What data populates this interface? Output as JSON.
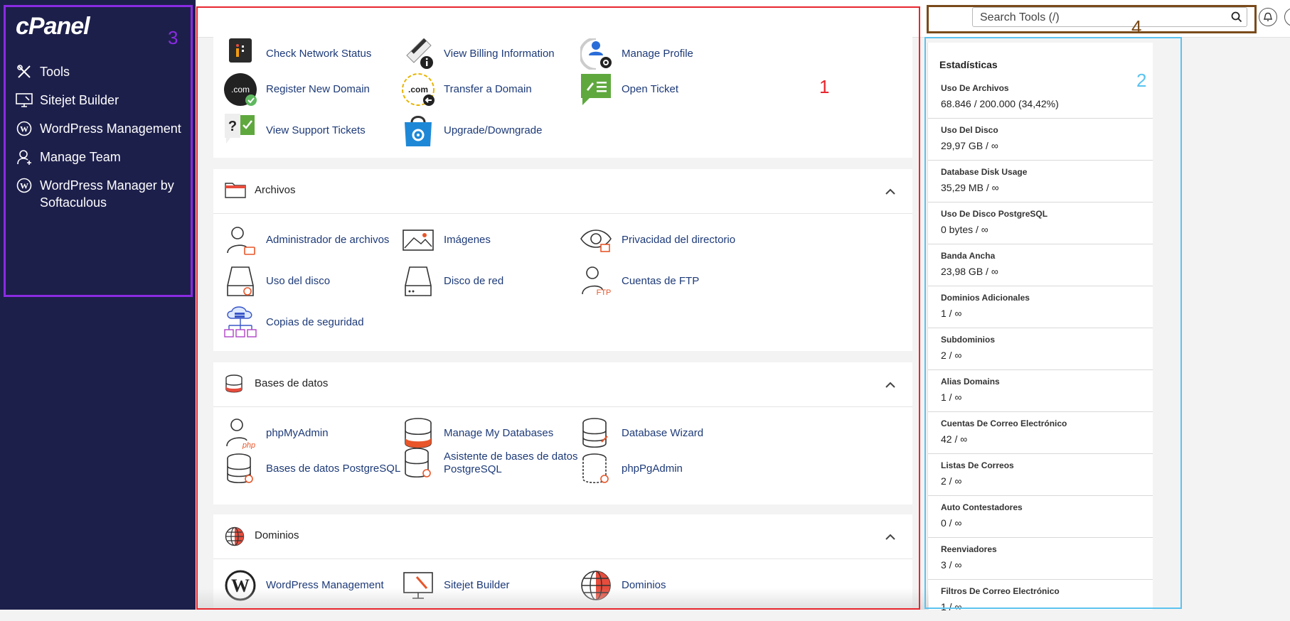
{
  "sidebar": {
    "logo": "cPanel",
    "items": [
      {
        "label": "Tools",
        "icon": "tools-icon"
      },
      {
        "label": "Sitejet Builder",
        "icon": "monitor-icon"
      },
      {
        "label": "WordPress Management",
        "icon": "wordpress-icon"
      },
      {
        "label": "Manage Team",
        "icon": "user-icon"
      },
      {
        "label": "WordPress Manager by Softaculous",
        "icon": "wordpress-icon"
      }
    ]
  },
  "header": {
    "search_placeholder": "Search Tools (/)"
  },
  "annotations": {
    "box1": "1",
    "box2": "2",
    "box3": "3",
    "box4": "4",
    "colors": {
      "box1": "#e8262f",
      "box2": "#5bc3f0",
      "box3": "#8a2be2",
      "box4": "#7a4a1a"
    }
  },
  "general": {
    "tools": [
      {
        "label": "Check Network Status",
        "icon": "network-status-icon"
      },
      {
        "label": "View Billing Information",
        "icon": "billing-icon"
      },
      {
        "label": "Manage Profile",
        "icon": "profile-icon"
      },
      {
        "label": "Register New Domain",
        "icon": "register-domain-icon"
      },
      {
        "label": "Transfer a Domain",
        "icon": "transfer-domain-icon"
      },
      {
        "label": "Open Ticket",
        "icon": "ticket-icon"
      },
      {
        "label": "View Support Tickets",
        "icon": "support-tickets-icon"
      },
      {
        "label": "Upgrade/Downgrade",
        "icon": "upgrade-icon"
      }
    ]
  },
  "archivos": {
    "title": "Archivos",
    "tools": [
      {
        "label": "Administrador de archivos",
        "icon": "file-manager-icon"
      },
      {
        "label": "Imágenes",
        "icon": "images-icon"
      },
      {
        "label": "Privacidad del directorio",
        "icon": "directory-privacy-icon"
      },
      {
        "label": "Uso del disco",
        "icon": "disk-usage-icon"
      },
      {
        "label": "Disco de red",
        "icon": "network-disk-icon"
      },
      {
        "label": "Cuentas de FTP",
        "icon": "ftp-icon"
      },
      {
        "label": "Copias de seguridad",
        "icon": "backup-icon"
      }
    ]
  },
  "bases": {
    "title": "Bases de datos",
    "tools": [
      {
        "label": "phpMyAdmin",
        "icon": "phpmyadmin-icon"
      },
      {
        "label": "Manage My Databases",
        "icon": "database-icon"
      },
      {
        "label": "Database Wizard",
        "icon": "database-wizard-icon"
      },
      {
        "label": "Bases de datos PostgreSQL",
        "icon": "postgresql-icon"
      },
      {
        "label": "Asistente de bases de datos PostgreSQL",
        "icon": "postgresql-wizard-icon"
      },
      {
        "label": "phpPgAdmin",
        "icon": "phppgadmin-icon"
      }
    ]
  },
  "dominios": {
    "title": "Dominios",
    "tools": [
      {
        "label": "WordPress Management",
        "icon": "wordpress-icon"
      },
      {
        "label": "Sitejet Builder",
        "icon": "sitejet-icon"
      },
      {
        "label": "Dominios",
        "icon": "globe-icon"
      }
    ]
  },
  "stats": {
    "title": "Estadísticas",
    "items": [
      {
        "label": "Uso De Archivos",
        "value": "68.846 / 200.000   (34,42%)"
      },
      {
        "label": "Uso Del Disco",
        "value": "29,97 GB / ∞"
      },
      {
        "label": "Database Disk Usage",
        "value": "35,29 MB / ∞"
      },
      {
        "label": "Uso De Disco PostgreSQL",
        "value": "0 bytes / ∞"
      },
      {
        "label": "Banda Ancha",
        "value": "23,98 GB / ∞"
      },
      {
        "label": "Dominios Adicionales",
        "value": "1 / ∞"
      },
      {
        "label": "Subdominios",
        "value": "2 / ∞"
      },
      {
        "label": "Alias Domains",
        "value": "1 / ∞"
      },
      {
        "label": "Cuentas De Correo Electrónico",
        "value": "42 / ∞"
      },
      {
        "label": "Listas De Correos",
        "value": "2 / ∞"
      },
      {
        "label": "Auto Contestadores",
        "value": "0 / ∞"
      },
      {
        "label": "Reenviadores",
        "value": "3 / ∞"
      },
      {
        "label": "Filtros De Correo Electrónico",
        "value": "1 / ∞"
      }
    ]
  }
}
